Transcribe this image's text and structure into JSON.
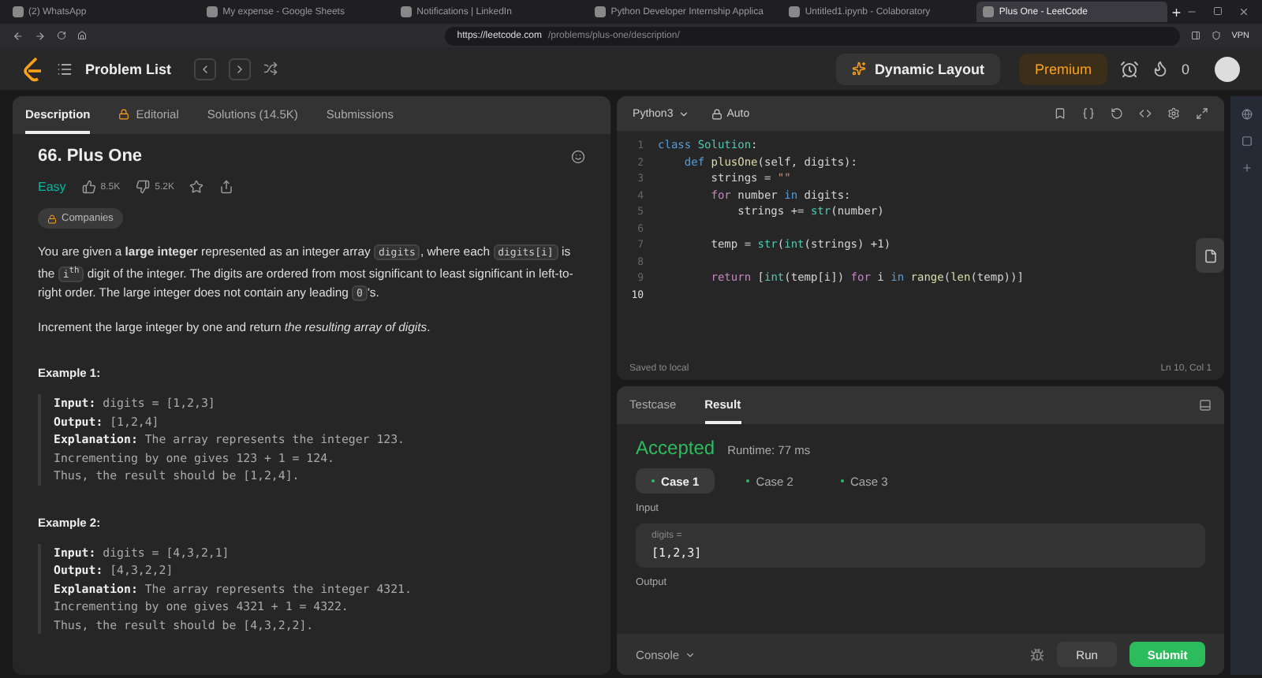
{
  "browser": {
    "tabs": [
      {
        "title": "(2) WhatsApp",
        "selected": false
      },
      {
        "title": "My expense - Google Sheets",
        "selected": false
      },
      {
        "title": "Notifications | LinkedIn",
        "selected": false
      },
      {
        "title": "Python Developer Internship Applica",
        "selected": false
      },
      {
        "title": "Untitled1.ipynb - Colaboratory",
        "selected": false
      },
      {
        "title": "Plus One - LeetCode",
        "selected": true
      }
    ],
    "url_host": "https://leetcode.com",
    "url_path": "/problems/plus-one/description/",
    "vpn": "VPN"
  },
  "nav": {
    "problem_list": "Problem List",
    "dynamic_layout": "Dynamic Layout",
    "premium": "Premium",
    "streak": "0"
  },
  "description": {
    "tabs": [
      {
        "label": "Description",
        "selected": true,
        "locked": false
      },
      {
        "label": "Editorial",
        "selected": false,
        "locked": true
      },
      {
        "label": "Solutions (14.5K)",
        "selected": false,
        "locked": false
      },
      {
        "label": "Submissions",
        "selected": false,
        "locked": false
      }
    ],
    "title": "66. Plus One",
    "difficulty": "Easy",
    "likes": "8.5K",
    "dislikes": "5.2K",
    "companies": "Companies",
    "paragraphs": [
      [
        {
          "kind": "text",
          "text": "You are given a "
        },
        {
          "kind": "bold",
          "text": "large integer"
        },
        {
          "kind": "text",
          "text": " represented as an integer array "
        },
        {
          "kind": "code",
          "text": "digits"
        },
        {
          "kind": "text",
          "text": ", where each "
        },
        {
          "kind": "code",
          "text": "digits[i]"
        },
        {
          "kind": "text",
          "text": " is the "
        },
        {
          "kind": "code",
          "text": "i$^{th}$"
        },
        {
          "kind": "text",
          "text": " digit of the integer. The digits are ordered from most significant to least significant in left-to-right order. The large integer does not contain any leading "
        },
        {
          "kind": "code",
          "text": "0"
        },
        {
          "kind": "text",
          "text": "'s."
        }
      ],
      [
        {
          "kind": "text",
          "text": "Increment the large integer by one and return "
        },
        {
          "kind": "italic",
          "text": "the resulting array of digits"
        },
        {
          "kind": "text",
          "text": "."
        }
      ]
    ],
    "examples": [
      {
        "heading": "Example 1:",
        "lines": [
          {
            "label": "Input:",
            "value": "digits = [1,2,3]"
          },
          {
            "label": "Output:",
            "value": "[1,2,4]"
          },
          {
            "label": "Explanation:",
            "value": "The array represents the integer 123."
          },
          {
            "value": "Incrementing by one gives 123 + 1 = 124."
          },
          {
            "value": "Thus, the result should be [1,2,4]."
          }
        ]
      },
      {
        "heading": "Example 2:",
        "lines": [
          {
            "label": "Input:",
            "value": "digits = [4,3,2,1]"
          },
          {
            "label": "Output:",
            "value": "[4,3,2,2]"
          },
          {
            "label": "Explanation:",
            "value": "The array represents the integer 4321."
          },
          {
            "value": "Incrementing by one gives 4321 + 1 = 4322."
          },
          {
            "value": "Thus, the result should be [4,3,2,2]."
          }
        ]
      }
    ]
  },
  "editor": {
    "language": "Python3",
    "mode": "Auto",
    "lines": [
      {
        "number": "1",
        "current": false,
        "tokens": [
          {
            "kind": "kw",
            "text": "class"
          },
          {
            "kind": "cls",
            "text": " Solution"
          },
          {
            "kind": "p",
            "text": ":"
          }
        ]
      },
      {
        "number": "2",
        "current": false,
        "tokens": [
          {
            "kind": "kw",
            "text": "    def"
          },
          {
            "kind": "fn",
            "text": " plusOne"
          },
          {
            "kind": "p",
            "text": "(self, digits):"
          }
        ]
      },
      {
        "number": "3",
        "current": false,
        "tokens": [
          {
            "kind": "p",
            "text": "        strings = "
          },
          {
            "kind": "str",
            "text": "\"\""
          }
        ]
      },
      {
        "number": "4",
        "current": false,
        "tokens": [
          {
            "kind": "ctl",
            "text": "        for"
          },
          {
            "kind": "p",
            "text": " number "
          },
          {
            "kind": "kw",
            "text": "in"
          },
          {
            "kind": "p",
            "text": " digits:"
          }
        ]
      },
      {
        "number": "5",
        "current": false,
        "tokens": [
          {
            "kind": "p",
            "text": "            strings += "
          },
          {
            "kind": "bi",
            "text": "str"
          },
          {
            "kind": "p",
            "text": "(number)"
          }
        ]
      },
      {
        "number": "6",
        "current": false
      },
      {
        "number": "7",
        "current": false,
        "tokens": [
          {
            "kind": "p",
            "text": "        temp = "
          },
          {
            "kind": "bi",
            "text": "str"
          },
          {
            "kind": "p",
            "text": "("
          },
          {
            "kind": "bi",
            "text": "int"
          },
          {
            "kind": "p",
            "text": "(strings) +1)"
          }
        ]
      },
      {
        "number": "8",
        "current": false
      },
      {
        "number": "9",
        "current": false,
        "tokens": [
          {
            "kind": "ctl",
            "text": "        return"
          },
          {
            "kind": "p",
            "text": " ["
          },
          {
            "kind": "bi",
            "text": "int"
          },
          {
            "kind": "p",
            "text": "(temp[i]) "
          },
          {
            "kind": "ctl",
            "text": "for"
          },
          {
            "kind": "p",
            "text": " i "
          },
          {
            "kind": "kw",
            "text": "in"
          },
          {
            "kind": "fn",
            "text": " range"
          },
          {
            "kind": "p",
            "text": "("
          },
          {
            "kind": "fn",
            "text": "len"
          },
          {
            "kind": "p",
            "text": "(temp))]"
          }
        ]
      },
      {
        "number": "10",
        "current": true
      }
    ],
    "status": "Saved to local",
    "cursor": "Ln 10, Col 1"
  },
  "result": {
    "tabs": [
      {
        "label": "Testcase",
        "selected": false
      },
      {
        "label": "Result",
        "selected": true
      }
    ],
    "verdict": "Accepted",
    "runtime": "Runtime: 77 ms",
    "cases": [
      {
        "label": "Case 1",
        "selected": true
      },
      {
        "label": "Case 2",
        "selected": false
      },
      {
        "label": "Case 3",
        "selected": false
      }
    ],
    "input_label": "Input",
    "input_name": "digits =",
    "input_value": "[1,2,3]",
    "output_label": "Output",
    "console": "Console",
    "run": "Run",
    "submit": "Submit"
  }
}
